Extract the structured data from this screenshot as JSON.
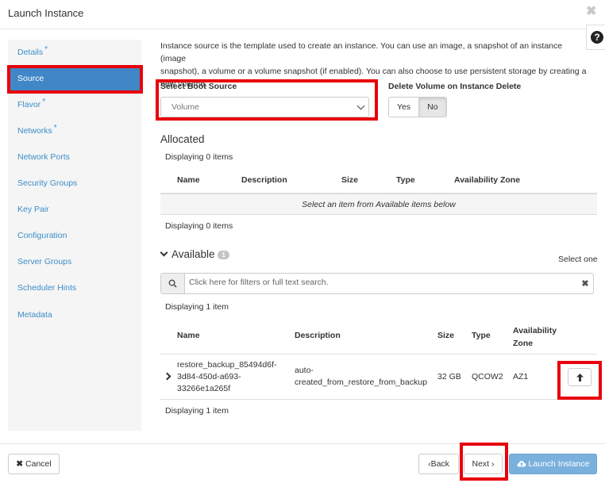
{
  "modal": {
    "title": "Launch Instance",
    "close_glyph": "✖",
    "help_glyph": "?"
  },
  "sidebar": {
    "items": [
      {
        "label": "Details",
        "required": true,
        "active": false
      },
      {
        "label": "Source",
        "required": false,
        "active": true
      },
      {
        "label": "Flavor",
        "required": true,
        "active": false
      },
      {
        "label": "Networks",
        "required": true,
        "active": false
      },
      {
        "label": "Network Ports",
        "required": false,
        "active": false
      },
      {
        "label": "Security Groups",
        "required": false,
        "active": false
      },
      {
        "label": "Key Pair",
        "required": false,
        "active": false
      },
      {
        "label": "Configuration",
        "required": false,
        "active": false
      },
      {
        "label": "Server Groups",
        "required": false,
        "active": false
      },
      {
        "label": "Scheduler Hints",
        "required": false,
        "active": false
      },
      {
        "label": "Metadata",
        "required": false,
        "active": false
      }
    ],
    "required_mark": "*"
  },
  "source": {
    "description_lines": [
      "Instance source is the template used to create an instance. You can use an image, a snapshot of an instance (image",
      "snapshot), a volume or a volume snapshot (if enabled). You can also choose to use persistent storage by creating a",
      "new volume."
    ],
    "boot_source_label": "Select Boot Source",
    "boot_source_value": "Volume",
    "delete_volume_label": "Delete Volume on Instance Delete",
    "delete_yes": "Yes",
    "delete_no": "No",
    "delete_selected": "No"
  },
  "allocated": {
    "title": "Allocated",
    "count_text": "Displaying 0 items",
    "columns": [
      "Name",
      "Description",
      "Size",
      "Type",
      "Availability Zone"
    ],
    "empty_text": "Select an item from Available items below",
    "footer_count": "Displaying 0 items"
  },
  "available": {
    "title": "Available",
    "badge": "1",
    "select_hint": "Select one",
    "search_placeholder": "Click here for filters or full text search.",
    "clear_glyph": "✖",
    "count_text": "Displaying 1 item",
    "columns": [
      "Name",
      "Description",
      "Size",
      "Type",
      "Availability",
      "Zone"
    ],
    "rows": [
      {
        "name_lines": [
          "restore_backup_85494d6f-",
          "3d84-450d-a693-",
          "33266e1a265f"
        ],
        "description_lines": [
          "auto-",
          "created_from_restore_from_backup"
        ],
        "size": "32 GB",
        "type": "QCOW2",
        "zone": "AZ1"
      }
    ],
    "footer_count": "Displaying 1 item"
  },
  "footer": {
    "cancel_label": "Cancel",
    "back_label": "Back",
    "next_label": "Next",
    "launch_label": "Launch Instance"
  },
  "colors": {
    "highlight": "#e8000b",
    "accent": "#3f87c6",
    "link": "#3b8dc9"
  }
}
